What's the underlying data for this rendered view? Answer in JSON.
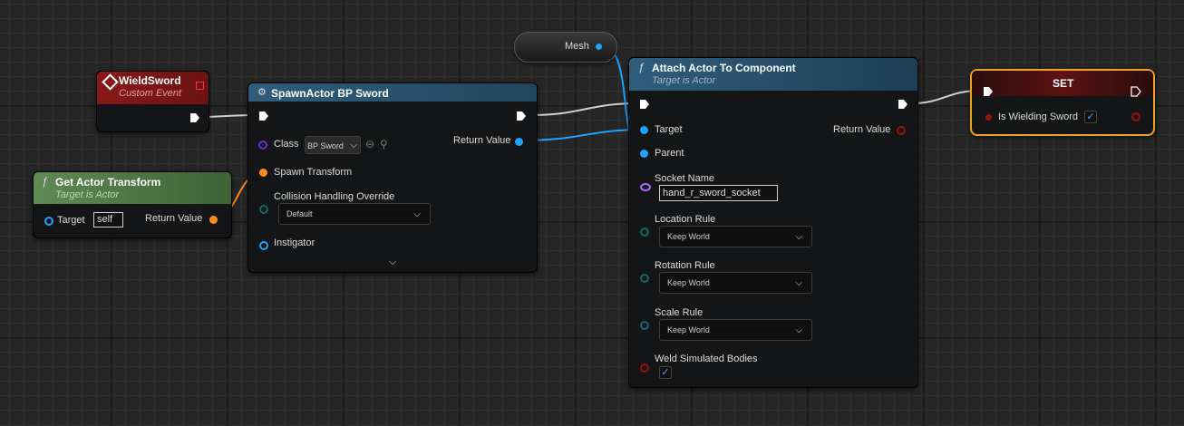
{
  "colors": {
    "exec": "#ffffff",
    "object": "#1ea3ff",
    "transform": "#ff8c1a",
    "class": "#6a2ccf",
    "boolean": "#9a1010",
    "name": "#b36bff",
    "enum": "#0e6b66",
    "event_header": "#8a1818",
    "function_header": "#2d5a7a",
    "pure_header": "#4f7a46",
    "set_header": "#551010",
    "set_border": "#f2a21a"
  },
  "mesh_node": {
    "label": "Mesh"
  },
  "wield_event": {
    "title": "WieldSword",
    "subtitle": "Custom Event",
    "icon": "event-diamond-icon"
  },
  "get_actor_transform": {
    "title": "Get Actor Transform",
    "subtitle": "Target is Actor",
    "target_label": "Target",
    "target_value": "self",
    "return_label": "Return Value"
  },
  "spawn_actor": {
    "title": "SpawnActor BP Sword",
    "class_label": "Class",
    "class_value": "BP Sword",
    "spawn_transform_label": "Spawn Transform",
    "collision_label": "Collision Handling Override",
    "collision_value": "Default",
    "instigator_label": "Instigator",
    "return_label": "Return Value"
  },
  "attach_actor": {
    "title": "Attach Actor To Component",
    "subtitle": "Target is Actor",
    "target_label": "Target",
    "parent_label": "Parent",
    "return_label": "Return Value",
    "socket_label": "Socket Name",
    "socket_value": "hand_r_sword_socket",
    "location_label": "Location Rule",
    "location_value": "Keep World",
    "rotation_label": "Rotation Rule",
    "rotation_value": "Keep World",
    "scale_label": "Scale Rule",
    "scale_value": "Keep World",
    "weld_label": "Weld Simulated Bodies",
    "weld_checked": true
  },
  "set_node": {
    "title": "SET",
    "var_label": "Is Wielding Sword",
    "var_checked": true
  }
}
